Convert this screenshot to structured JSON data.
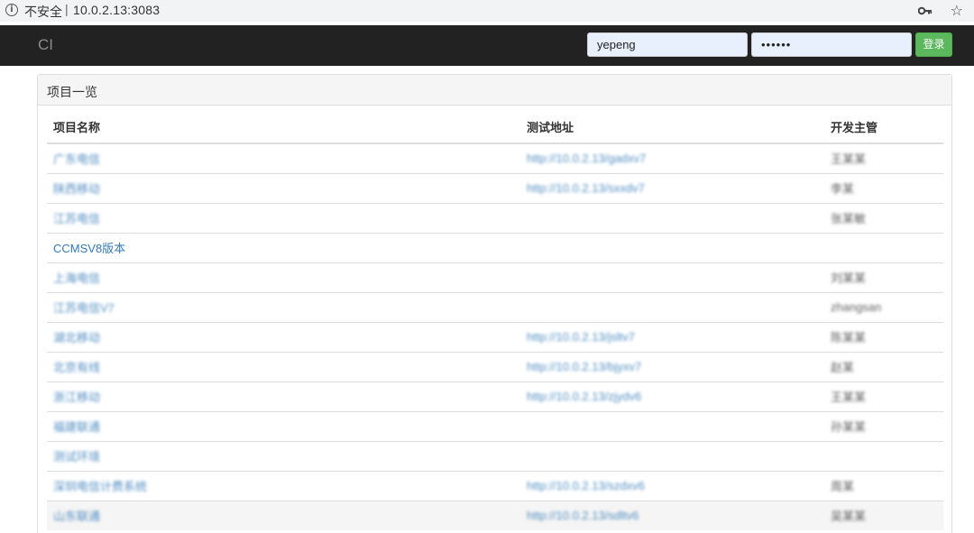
{
  "browser": {
    "security_label": "不安全",
    "url": "10.0.2.13:3083"
  },
  "navbar": {
    "brand": "CI",
    "username_value": "yepeng",
    "password_value": "••••••",
    "login_label": "登录"
  },
  "panel": {
    "title": "项目一览",
    "columns": [
      "项目名称",
      "测试地址",
      "开发主管"
    ],
    "rows": [
      {
        "name": "广东电信",
        "url": "http://10.0.2.13/gadxv7",
        "manager": "王某某"
      },
      {
        "name": "陕西移动",
        "url": "http://10.0.2.13/sxxdv7",
        "manager": "李某"
      },
      {
        "name": "江苏电信",
        "url": "",
        "manager": "张某敏"
      },
      {
        "name": "CCMSV8版本",
        "url": "",
        "manager": ""
      },
      {
        "name": "上海电信",
        "url": "",
        "manager": "刘某某"
      },
      {
        "name": "江苏电信V7",
        "url": "",
        "manager": "zhangsan"
      },
      {
        "name": "湖北移动",
        "url": "http://10.0.2.13/jsltv7",
        "manager": "陈某某"
      },
      {
        "name": "北京有线",
        "url": "http://10.0.2.13/bjyxv7",
        "manager": "赵某"
      },
      {
        "name": "浙江移动",
        "url": "http://10.0.2.13/zjydv6",
        "manager": "王某某"
      },
      {
        "name": "福建联通",
        "url": "",
        "manager": "孙某某"
      },
      {
        "name": "测试环境",
        "url": "",
        "manager": ""
      },
      {
        "name": "深圳电信计费系统",
        "url": "http://10.0.2.13/szdxv6",
        "manager": "周某"
      },
      {
        "name": "山东联通",
        "url": "http://10.0.2.13/sdltv6",
        "manager": "吴某某"
      }
    ]
  }
}
